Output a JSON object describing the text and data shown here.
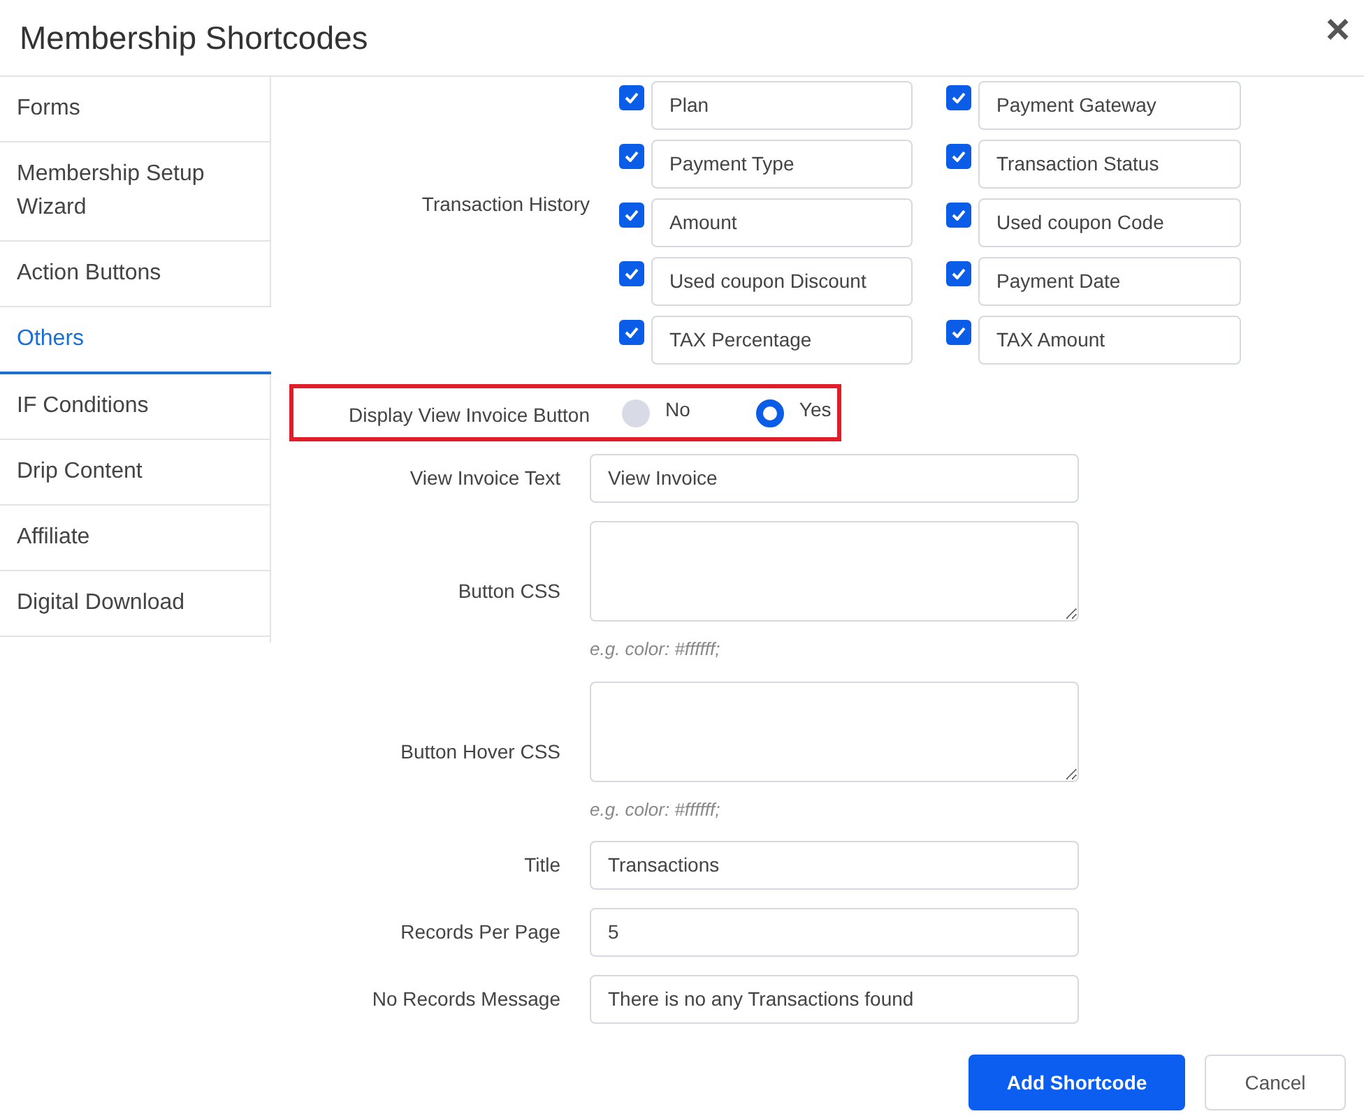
{
  "dialog": {
    "title": "Membership Shortcodes",
    "close": "×"
  },
  "sidebar": {
    "items": [
      {
        "label": "Forms",
        "selected": false
      },
      {
        "label": "Membership Setup Wizard",
        "selected": false
      },
      {
        "label": "Action Buttons",
        "selected": false
      },
      {
        "label": "Others",
        "selected": true
      },
      {
        "label": "IF Conditions",
        "selected": false
      },
      {
        "label": "Drip Content",
        "selected": false
      },
      {
        "label": "Affiliate",
        "selected": false
      },
      {
        "label": "Digital Download",
        "selected": false
      }
    ]
  },
  "transaction_history": {
    "label": "Transaction History",
    "columns": [
      {
        "label": "Plan",
        "checked": true
      },
      {
        "label": "Payment Gateway",
        "checked": true
      },
      {
        "label": "Payment Type",
        "checked": true
      },
      {
        "label": "Transaction Status",
        "checked": true
      },
      {
        "label": "Amount",
        "checked": true
      },
      {
        "label": "Used coupon Code",
        "checked": true
      },
      {
        "label": "Used coupon Discount",
        "checked": true
      },
      {
        "label": "Payment Date",
        "checked": true
      },
      {
        "label": "TAX Percentage",
        "checked": true
      },
      {
        "label": "TAX Amount",
        "checked": true
      }
    ]
  },
  "invoice_button": {
    "label": "Display View Invoice Button",
    "options": [
      {
        "label": "No",
        "selected": false
      },
      {
        "label": "Yes",
        "selected": true
      }
    ]
  },
  "fields": [
    {
      "kind": "input",
      "label": "View Invoice Text",
      "value": "View Invoice"
    },
    {
      "kind": "textarea",
      "label": "Button CSS",
      "hint": "e.g. color: #ffffff;"
    },
    {
      "kind": "textarea",
      "label": "Button Hover CSS",
      "hint": "e.g. color: #ffffff;"
    },
    {
      "kind": "input",
      "label": "Title",
      "value": "Transactions"
    },
    {
      "kind": "input",
      "label": "Records Per Page",
      "value": "5"
    },
    {
      "kind": "input",
      "label": "No Records Message",
      "value": "There is no any Transactions found"
    }
  ],
  "buttons": [
    {
      "label": "Add Shortcode",
      "kind": "primary"
    },
    {
      "label": "Cancel",
      "kind": "secondary"
    }
  ]
}
